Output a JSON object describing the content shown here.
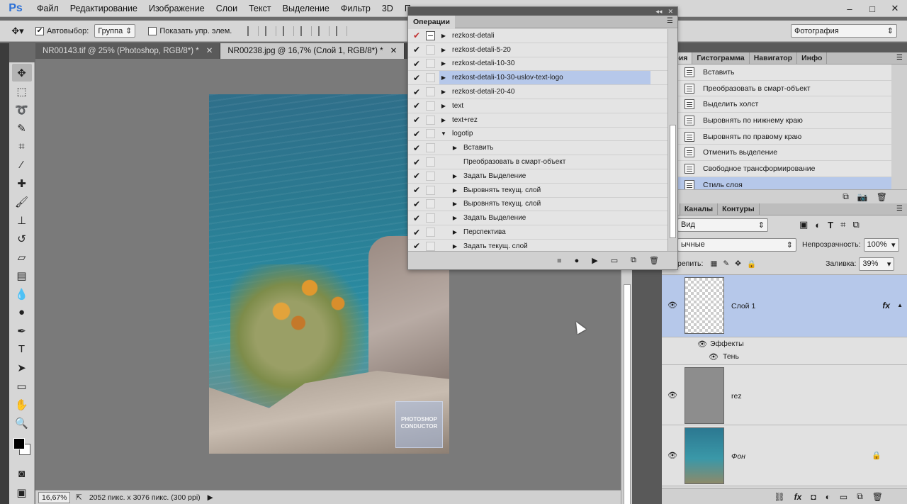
{
  "app": {
    "logo": "Ps",
    "menu": [
      "Файл",
      "Редактирование",
      "Изображение",
      "Слои",
      "Текст",
      "Выделение",
      "Фильтр",
      "3D",
      "Пр"
    ],
    "window_controls": [
      "–",
      "□",
      "✕"
    ]
  },
  "options_bar": {
    "auto_select_label": "Автовыбор:",
    "auto_select_checked": true,
    "auto_select_mode": "Группа",
    "show_transform_label": "Показать упр. элем.",
    "show_transform_checked": false,
    "workspace": "Фотография"
  },
  "doc_tabs": [
    {
      "label": "NR00143.tif @ 25% (Photoshop, RGB/8*) *",
      "active": false
    },
    {
      "label": "NR00238.jpg @ 16,7% (Слой 1, RGB/8*) *",
      "active": true
    }
  ],
  "canvas": {
    "watermark_text": "PHOTOSHOP CONDUCTOR"
  },
  "status_bar": {
    "zoom": "16,67%",
    "doc_info": "2052 пикс. x 3076 пикс. (300 ppi)"
  },
  "actions_panel": {
    "tab_label": "Операции",
    "items": [
      {
        "label": "rezkost-detali",
        "level": 1,
        "expanded": false,
        "checked": true,
        "check_color": "red",
        "dialog": true
      },
      {
        "label": "rezkost-detali-5-20",
        "level": 1,
        "expanded": false,
        "checked": true
      },
      {
        "label": "rezkost-detali-10-30",
        "level": 1,
        "expanded": false,
        "checked": true
      },
      {
        "label": "rezkost-detali-10-30-uslov-text-logo",
        "level": 1,
        "expanded": false,
        "checked": true,
        "selected": true
      },
      {
        "label": "rezkost-detali-20-40",
        "level": 1,
        "expanded": false,
        "checked": true
      },
      {
        "label": "text",
        "level": 1,
        "expanded": false,
        "checked": true
      },
      {
        "label": "text+rez",
        "level": 1,
        "expanded": false,
        "checked": true
      },
      {
        "label": "logotip",
        "level": 1,
        "expanded": true,
        "checked": true
      },
      {
        "label": "Вставить",
        "level": 2,
        "expanded": false,
        "checked": true,
        "has_children": true
      },
      {
        "label": "Преобразовать в смарт-объект",
        "level": 2,
        "checked": true,
        "has_children": false
      },
      {
        "label": "Задать Выделение",
        "level": 2,
        "checked": true,
        "has_children": true
      },
      {
        "label": "Выровнять текущ. слой",
        "level": 2,
        "checked": true,
        "has_children": true
      },
      {
        "label": "Выровнять текущ. слой",
        "level": 2,
        "checked": true,
        "has_children": true
      },
      {
        "label": "Задать Выделение",
        "level": 2,
        "checked": true,
        "has_children": true
      },
      {
        "label": "Перспектива",
        "level": 2,
        "checked": true,
        "has_children": true
      },
      {
        "label": "Задать текущ. слой",
        "level": 2,
        "checked": true,
        "has_children": true
      }
    ]
  },
  "history_panel": {
    "tabs": [
      "тория",
      "Гистограмма",
      "Навигатор",
      "Инфо"
    ],
    "items": [
      {
        "label": "Вставить",
        "selected": false
      },
      {
        "label": "Преобразовать в смарт-объект",
        "selected": false
      },
      {
        "label": "Выделить холст",
        "selected": false
      },
      {
        "label": "Выровнять по нижнему краю",
        "selected": false
      },
      {
        "label": "Выровнять по правому краю",
        "selected": false
      },
      {
        "label": "Отменить выделение",
        "selected": false
      },
      {
        "label": "Свободное трансформирование",
        "selected": false
      },
      {
        "label": "Стиль слоя",
        "selected": true
      }
    ]
  },
  "layers_panel": {
    "tabs": [
      "ои",
      "Каналы",
      "Контуры"
    ],
    "filter_kind": "Вид",
    "blend_mode": "ычные",
    "opacity_label": "Непрозрачность:",
    "opacity_value": "100%",
    "lock_label": "репить:",
    "fill_label": "Заливка:",
    "fill_value": "39%",
    "layers": [
      {
        "name": "Слой 1",
        "selected": true,
        "visible": true,
        "has_fx": true,
        "fx_label": "fx",
        "effects_label": "Эффекты",
        "effect_items": [
          "Тень"
        ]
      },
      {
        "name": "rez",
        "selected": false,
        "visible": true
      },
      {
        "name": "Фон",
        "selected": false,
        "visible": true,
        "locked": true
      }
    ]
  }
}
